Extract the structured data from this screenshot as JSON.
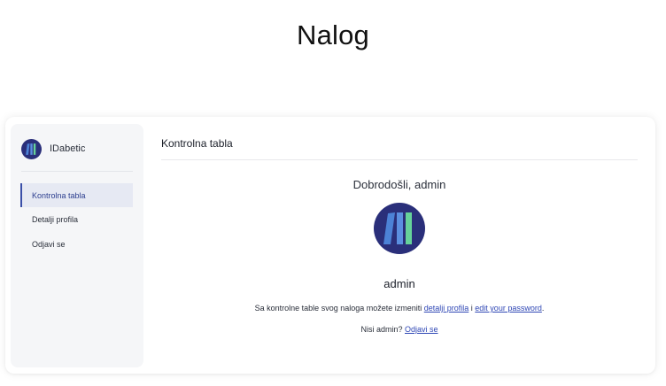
{
  "page": {
    "title": "Nalog"
  },
  "sidebar": {
    "brand": {
      "name": "IDabetic",
      "logo_icon": "books-logo-icon"
    },
    "items": [
      {
        "label": "Kontrolna tabla",
        "active": true
      },
      {
        "label": "Detalji profila",
        "active": false
      },
      {
        "label": "Odjavi se",
        "active": false
      }
    ]
  },
  "main": {
    "title": "Kontrolna tabla",
    "welcome": "Dobrodošli, admin",
    "avatar_icon": "books-avatar-icon",
    "username": "admin",
    "description": {
      "prefix": "Sa kontrolne table svog naloga možete izmeniti ",
      "link1": "detalji profila",
      "middle": " i ",
      "link2": "edit your password",
      "suffix": "."
    },
    "not_admin": {
      "prefix": "Nisi admin? ",
      "link": "Odjavi se"
    }
  },
  "colors": {
    "accent": "#2f47b5",
    "logo_bg": "#2a2f7a",
    "logo_green": "#66d29a",
    "logo_blue": "#4c82d6"
  }
}
